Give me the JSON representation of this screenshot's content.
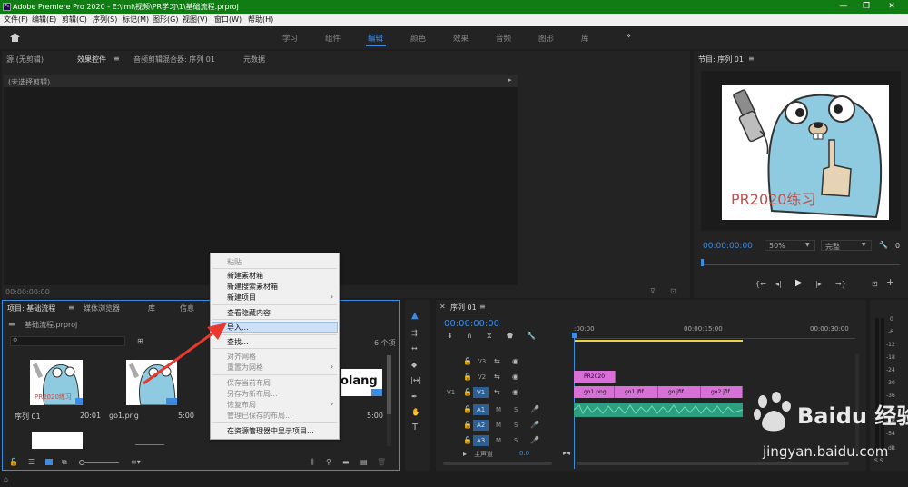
{
  "titlebar": {
    "title": "Adobe Premiere Pro 2020 - E:\\imi\\视频\\PR学习\\1\\基础流程.prproj",
    "min": "—",
    "max": "❐",
    "close": "✕"
  },
  "menus": [
    "文件(F)",
    "编辑(E)",
    "剪辑(C)",
    "序列(S)",
    "标记(M)",
    "图形(G)",
    "视图(V)",
    "窗口(W)",
    "帮助(H)"
  ],
  "workspaces": [
    "学习",
    "组件",
    "编辑",
    "颜色",
    "效果",
    "音频",
    "图形",
    "库"
  ],
  "workspace_more": "»",
  "source_panel": {
    "tabs": [
      "源:(无剪辑)",
      "效果控件",
      "音频剪辑混合器: 序列 01",
      "元数据"
    ],
    "no_clip": "(未选择剪辑)",
    "timecode": "00:00:00:00"
  },
  "program": {
    "tab": "节目: 序列 01",
    "timecode": "00:00:00:00",
    "zoom": "50%",
    "quality": "完整",
    "frame_text": "PR2020练习"
  },
  "project": {
    "tabs": [
      "项目: 基础流程",
      "媒体浏览器",
      "库",
      "信息"
    ],
    "file": "基础流程.prproj",
    "count": "6 个项",
    "search_placeholder": "",
    "items": [
      {
        "name": "序列 01",
        "dur": "20:01",
        "thumb_text": "PR2020练习"
      },
      {
        "name": "go1.png",
        "dur": "5:00"
      },
      {
        "name": "",
        "dur": "5:00",
        "thumb_text": "olang"
      }
    ]
  },
  "context_menu": [
    {
      "label": "粘贴",
      "disabled": true
    },
    {
      "label": "新建素材箱"
    },
    {
      "label": "新建搜索素材箱"
    },
    {
      "label": "新建项目",
      "sub": true
    },
    {
      "label": "查看隐藏内容"
    },
    {
      "label": "导入..."
    },
    {
      "label": "查找..."
    },
    {
      "label": "对齐网格",
      "disabled": true
    },
    {
      "label": "重置为网格",
      "disabled": true,
      "sub": true
    },
    {
      "label": "保存当前布局",
      "disabled": true
    },
    {
      "label": "另存为新布局...",
      "disabled": true
    },
    {
      "label": "恢复布局",
      "disabled": true,
      "sub": true
    },
    {
      "label": "管理已保存的布局...",
      "disabled": true
    },
    {
      "label": "在资源管理器中显示项目..."
    }
  ],
  "timeline": {
    "tab": "序列 01",
    "timecode": "00:00:00:00",
    "ruler": [
      ":00:00",
      "00:00:15:00",
      "00:00:30:00"
    ],
    "tracks": [
      {
        "id": "V3"
      },
      {
        "id": "V2"
      },
      {
        "id": "V1",
        "src": "V1"
      },
      {
        "id": "A1"
      },
      {
        "id": "A2"
      },
      {
        "id": "A3"
      }
    ],
    "master": {
      "label": "主声道",
      "value": "0.0"
    },
    "clips": [
      {
        "name": "PR2020"
      },
      {
        "name": "go1.png"
      },
      {
        "name": "go1.jfif"
      },
      {
        "name": "go.jfif"
      },
      {
        "name": "go2.jfif"
      }
    ]
  },
  "meter": {
    "labels": [
      "0",
      "-6",
      "-12",
      "-18",
      "-24",
      "-30",
      "-36",
      "-42",
      "-48",
      "-54",
      "dB"
    ],
    "footer": "S S"
  },
  "watermark": {
    "text": "Baidu 经验",
    "url": "jingyan.baidu.com"
  }
}
